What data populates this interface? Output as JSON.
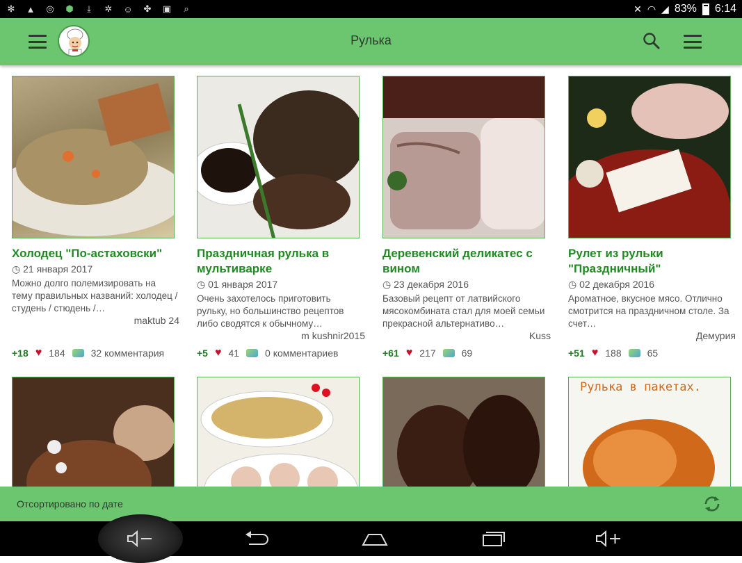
{
  "status_bar": {
    "battery": "83%",
    "time": "6:14",
    "left_icons": [
      "notification-icon",
      "warning-icon",
      "viber-icon",
      "shield-icon",
      "download-icon",
      "app-icon",
      "app-icon-2",
      "app-icon-3",
      "image-icon",
      "search-icon"
    ]
  },
  "app_bar": {
    "title": "Рулька"
  },
  "recipes": [
    {
      "title": "Холодец \"По-астаховски\"",
      "date": "21 января 2017",
      "description": "Можно долго полемизировать на тему правильных названий: холодец / студень / стюдень /…",
      "author": "maktub 24",
      "score": "+18",
      "likes": "184",
      "comments": "32 комментария",
      "thumb_colors": [
        "#8b7a55",
        "#d7c9a0"
      ]
    },
    {
      "title": "Праздничная рулька в мультиварке",
      "date": "01 января 2017",
      "description": "Очень захотелось приготовить рульку, но большинство рецептов либо сводятся к обычному…",
      "author": "m kushnir2015",
      "score": "+5",
      "likes": "41",
      "comments": "0 комментариев",
      "thumb_colors": [
        "#3b2a1e",
        "#e8e6e0"
      ]
    },
    {
      "title": "Деревенский деликатес с вином",
      "date": "23 декабря 2016",
      "description": "Базовый рецепт от латвийского мясокомбината стал для моей семьи прекрасной альтернативо…",
      "author": "Kuss",
      "score": "+61",
      "likes": "217",
      "comments": "69",
      "thumb_colors": [
        "#b89a94",
        "#efe4df"
      ]
    },
    {
      "title": "Рулет из рульки \"Праздничный\"",
      "date": "02 декабря 2016",
      "description": "Ароматное, вкусное мясо. Отлично смотрится на праздничном столе. За счет…",
      "author": "Демурия",
      "score": "+51",
      "likes": "188",
      "comments": "65",
      "thumb_colors": [
        "#8a1c14",
        "#2a3a22"
      ]
    },
    {
      "thumb_colors": [
        "#4a2e1e",
        "#b89070"
      ]
    },
    {
      "thumb_colors": [
        "#d4b36a",
        "#f2efe6"
      ]
    },
    {
      "thumb_colors": [
        "#3a1e14",
        "#7a6a5a"
      ]
    },
    {
      "thumb_text": "Рулька в пакетах.",
      "thumb_colors": [
        "#d06a1a",
        "#f6f6f0"
      ]
    }
  ],
  "sort_bar": {
    "label": "Отсортировано по дате"
  }
}
